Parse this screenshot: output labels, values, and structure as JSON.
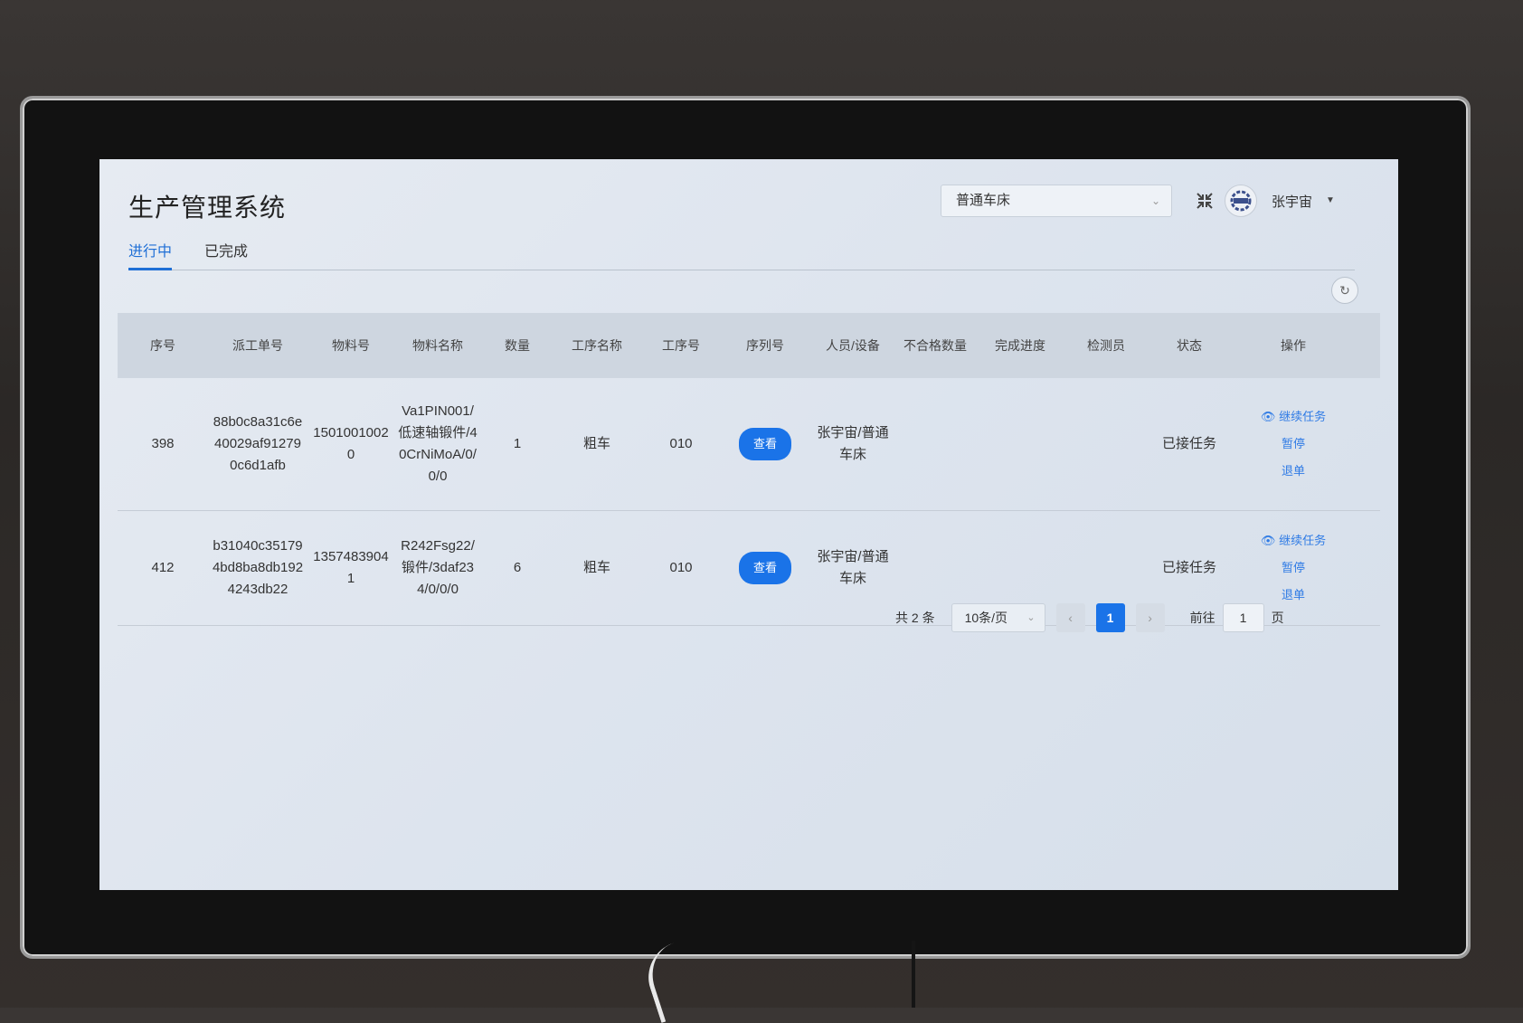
{
  "app": {
    "title": "生产管理系统"
  },
  "tabs": [
    {
      "label": "进行中",
      "active": true
    },
    {
      "label": "已完成",
      "active": false
    }
  ],
  "header": {
    "device_select": "普通车床",
    "user_name": "张宇宙"
  },
  "table": {
    "columns": [
      "序号",
      "派工单号",
      "物料号",
      "物料名称",
      "数量",
      "工序名称",
      "工序号",
      "序列号",
      "人员/设备",
      "不合格数量",
      "完成进度",
      "检测员",
      "状态",
      "操作"
    ],
    "rows": [
      {
        "seq": "398",
        "dispatch_no": "88b0c8a31c6e40029af912790c6d1afb",
        "material_no": "15010010020",
        "material_name": "Va1PIN001/低速轴锻件/40CrNiMoA/0/0/0",
        "qty": "1",
        "process_name": "粗车",
        "process_no": "010",
        "serial_btn": "查看",
        "person_device": "张宇宙/普通车床",
        "defect_qty": "",
        "progress": "",
        "inspector": "",
        "status": "已接任务",
        "actions": [
          "继续任务",
          "暂停",
          "退单"
        ]
      },
      {
        "seq": "412",
        "dispatch_no": "b31040c351794bd8ba8db1924243db22",
        "material_no": "13574839041",
        "material_name": "R242Fsg22/锻件/3daf234/0/0/0",
        "qty": "6",
        "process_name": "粗车",
        "process_no": "010",
        "serial_btn": "查看",
        "person_device": "张宇宙/普通车床",
        "defect_qty": "",
        "progress": "",
        "inspector": "",
        "status": "已接任务",
        "actions": [
          "继续任务",
          "暂停",
          "退单"
        ]
      }
    ]
  },
  "pagination": {
    "total_text": "共 2 条",
    "page_size": "10条/页",
    "current_page": "1",
    "goto_label": "前往",
    "goto_value": "1",
    "page_suffix": "页"
  },
  "colors": {
    "accent": "#1a73e8",
    "link": "#2f7be5"
  }
}
